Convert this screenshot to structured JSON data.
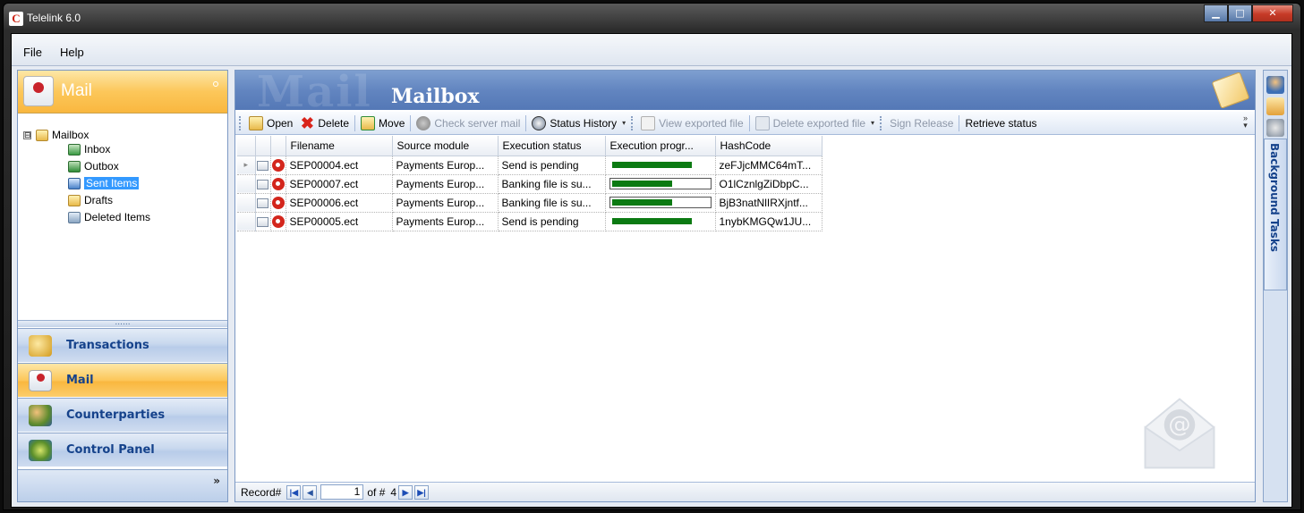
{
  "window": {
    "title": "Telelink 6.0",
    "controls": [
      "minimize",
      "maximize",
      "close"
    ]
  },
  "menu": {
    "items": [
      "File",
      "Help"
    ]
  },
  "nav": {
    "header_title": "Mail",
    "tree": {
      "root": "Mailbox",
      "root_expander": "⊟",
      "items": [
        "Inbox",
        "Outbox",
        "Sent Items",
        "Drafts",
        "Deleted Items"
      ],
      "selected": "Sent Items"
    },
    "splitter": "......",
    "buttons": [
      "Transactions",
      "Mail",
      "Counterparties",
      "Control Panel"
    ],
    "active_button": "Mail",
    "footer_chevron": "»"
  },
  "main": {
    "header_ghost": "Mail",
    "header_title": "Mailbox",
    "toolbar": {
      "open": "Open",
      "delete": "Delete",
      "move": "Move",
      "check_server_mail": "Check server mail",
      "status_history": "Status History",
      "view_exported_file": "View exported file",
      "delete_exported_file": "Delete exported file",
      "sign_release": "Sign Release",
      "retrieve_status": "Retrieve status"
    },
    "grid": {
      "columns": [
        "Filename",
        "Source module",
        "Execution status",
        "Execution progr...",
        "HashCode"
      ],
      "rows": [
        {
          "filename": "SEP00004.ect",
          "source": "Payments Europ...",
          "status": "Send is pending",
          "progress": 0.8,
          "hash": "zeFJjcMMC64mT..."
        },
        {
          "filename": "SEP00007.ect",
          "source": "Payments Europ...",
          "status": "Banking file is su...",
          "progress": 0.6,
          "hash": "O1lCznlgZiDbpC..."
        },
        {
          "filename": "SEP00006.ect",
          "source": "Payments Europ...",
          "status": "Banking file is su...",
          "progress": 0.6,
          "hash": "BjB3natNlIRXjntf..."
        },
        {
          "filename": "SEP00005.ect",
          "source": "Payments Europ...",
          "status": "Send is pending",
          "progress": 0.8,
          "hash": "1nybKMGQw1JU..."
        }
      ]
    },
    "statusbar": {
      "record_label": "Record#",
      "current": "1",
      "of_label": "of #",
      "total": "4"
    }
  },
  "dock": {
    "label": "Background Tasks"
  },
  "colors": {
    "accent": "#6285c0",
    "active_nav": "#f9b73f",
    "progress": "#0b7a12"
  }
}
